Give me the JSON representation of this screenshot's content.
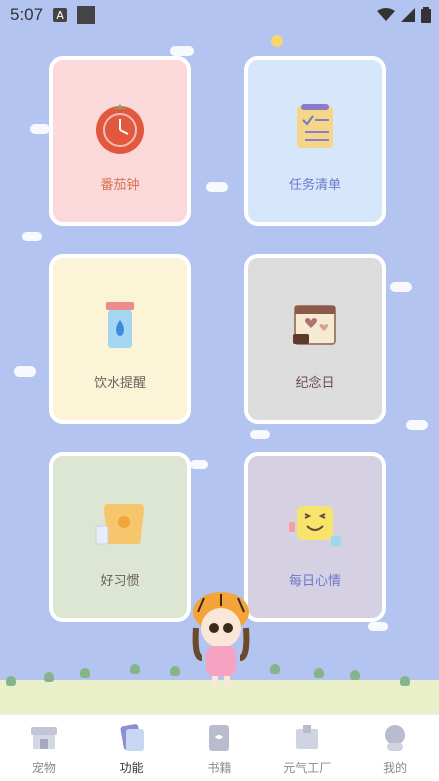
{
  "status_bar": {
    "time": "5:07",
    "a_badge": "A"
  },
  "cards": [
    {
      "label": "番茄钟",
      "bg": "#fbd9da",
      "label_color": "#d5744e",
      "icon": "tomato-clock-icon"
    },
    {
      "label": "任务清单",
      "bg": "#d6e6fb",
      "label_color": "#6c78c8",
      "icon": "checklist-icon"
    },
    {
      "label": "饮水提醒",
      "bg": "#fbf4d6",
      "label_color": "#6a6060",
      "icon": "water-cup-icon"
    },
    {
      "label": "纪念日",
      "bg": "#dcdcdc",
      "label_color": "#6a4e4e",
      "icon": "anniversary-calendar-icon"
    },
    {
      "label": "好习惯",
      "bg": "#dde5d3",
      "label_color": "#6a6060",
      "icon": "toast-milk-icon"
    },
    {
      "label": "每日心情",
      "bg": "#d6d0e3",
      "label_color": "#6c78c8",
      "icon": "smile-face-icon"
    }
  ],
  "tabs": [
    {
      "label": "宠物",
      "icon": "pet-shop-icon",
      "active": false
    },
    {
      "label": "功能",
      "icon": "cards-icon",
      "active": true
    },
    {
      "label": "书籍",
      "icon": "book-icon",
      "active": false
    },
    {
      "label": "元气工厂",
      "icon": "factory-icon",
      "active": false
    },
    {
      "label": "我的",
      "icon": "profile-icon",
      "active": false
    }
  ]
}
